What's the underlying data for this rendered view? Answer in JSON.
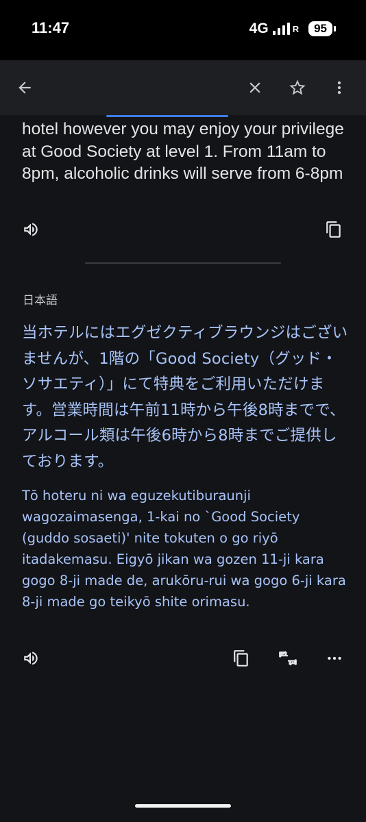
{
  "status_bar": {
    "time": "11:47",
    "network": "4G",
    "roaming": "R",
    "battery": "95"
  },
  "toolbar": {
    "back_icon": "arrow-back-icon",
    "close_icon": "close-icon",
    "star_icon": "star-outline-icon",
    "more_icon": "more-vertical-icon"
  },
  "source": {
    "text": "hotel however you may enjoy your privilege at Good Society at level 1. From 11am to 8pm, alcoholic drinks will serve from 6-8pm",
    "listen_icon": "speaker-icon",
    "copy_icon": "copy-icon"
  },
  "translation": {
    "language": "日本語",
    "text": "当ホテルにはエグゼクティブラウンジはございませんが、1階の「Good Society（グッド・ソサエティ）」にて特典をご利用いただけます。営業時間は午前11時から午後8時までで、アルコール類は午後6時から8時までご提供しております。",
    "romanization": "Tō hoteru ni wa eguzekutiburaunji wagozaimasenga, 1-kai no `Good Society (guddo sosaeti)' nite tokuten o go riyō itadakemasu. Eigyō jikan wa gozen 11-ji kara gogo 8-ji made de, arukōru-rui wa gogo 6-ji kara 8-ji made go teikyō shite orimasu.",
    "listen_icon": "speaker-icon",
    "copy_icon": "copy-icon",
    "feedback_icon": "thumbs-up-down-icon",
    "more_icon": "more-horizontal-icon"
  },
  "colors": {
    "background": "#131418",
    "toolbar": "#1e1f23",
    "accent": "#3f7de6",
    "translation_text": "#a7c3f7"
  }
}
